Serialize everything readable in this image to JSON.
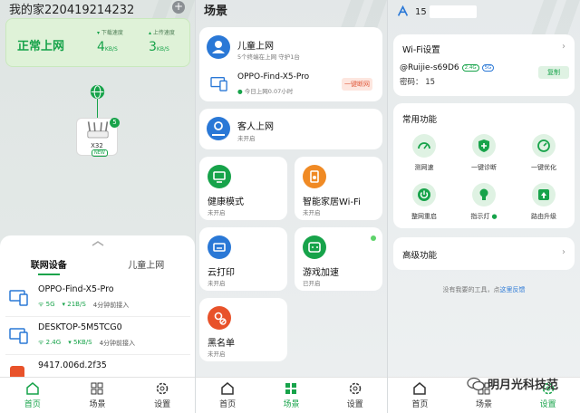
{
  "home": {
    "title": "我的家220419214232",
    "status": "正常上网",
    "download": {
      "label": "下载速度",
      "value": "4",
      "unit": "KB/S"
    },
    "upload": {
      "label": "上传速度",
      "value": "3",
      "unit": "KB/S"
    },
    "router": {
      "name": "X32",
      "tag": "NEW",
      "badge": "5"
    },
    "tabs": [
      "联网设备",
      "儿童上网"
    ],
    "devices": [
      {
        "name": "OPPO-Find-X5-Pro",
        "band": "5G",
        "rate": "21B/S",
        "time": "4分钟前接入"
      },
      {
        "name": "DESKTOP-5M5TCG0",
        "band": "2.4G",
        "rate": "5KB/S",
        "time": "4分钟前接入"
      },
      {
        "name": "9417.006d.2f35"
      }
    ]
  },
  "scene": {
    "title": "场景",
    "kids": {
      "title": "儿童上网",
      "sub": "5个终端在上网 守护1台",
      "device": "OPPO-Find-X5-Pro",
      "device_sub": "今日上网0.07小时",
      "button": "一键断网"
    },
    "guest": {
      "title": "客人上网",
      "sub": "未开启"
    },
    "health": {
      "title": "健康模式",
      "sub": "未开启"
    },
    "smart": {
      "title": "智能家居Wi-Fi",
      "sub": "未开启"
    },
    "print": {
      "title": "云打印",
      "sub": "未开启"
    },
    "game": {
      "title": "游戏加速",
      "sub": "已开启"
    },
    "black": {
      "title": "黑名单",
      "sub": "未开启"
    }
  },
  "settings": {
    "top_name": "15",
    "wifi_title": "Wi-Fi设置",
    "ssid": "@Ruijie-s69D6",
    "band1": "2.4G",
    "band2": "5G",
    "password": "密码： 15",
    "copy": "复制",
    "common_title": "常用功能",
    "functions": [
      "测网速",
      "一键诊断",
      "一键优化",
      "整网重启",
      "指示灯",
      "路由升级"
    ],
    "advanced": "高级功能",
    "feedback_pre": "没有我要的工具，点",
    "feedback_link": "这里反馈"
  },
  "nav": [
    "首页",
    "场景",
    "设置"
  ],
  "watermark": "明月光科技范",
  "colors": {
    "accent": "#17a34a",
    "warning": "#e05a3c",
    "link": "#2a78d6"
  }
}
